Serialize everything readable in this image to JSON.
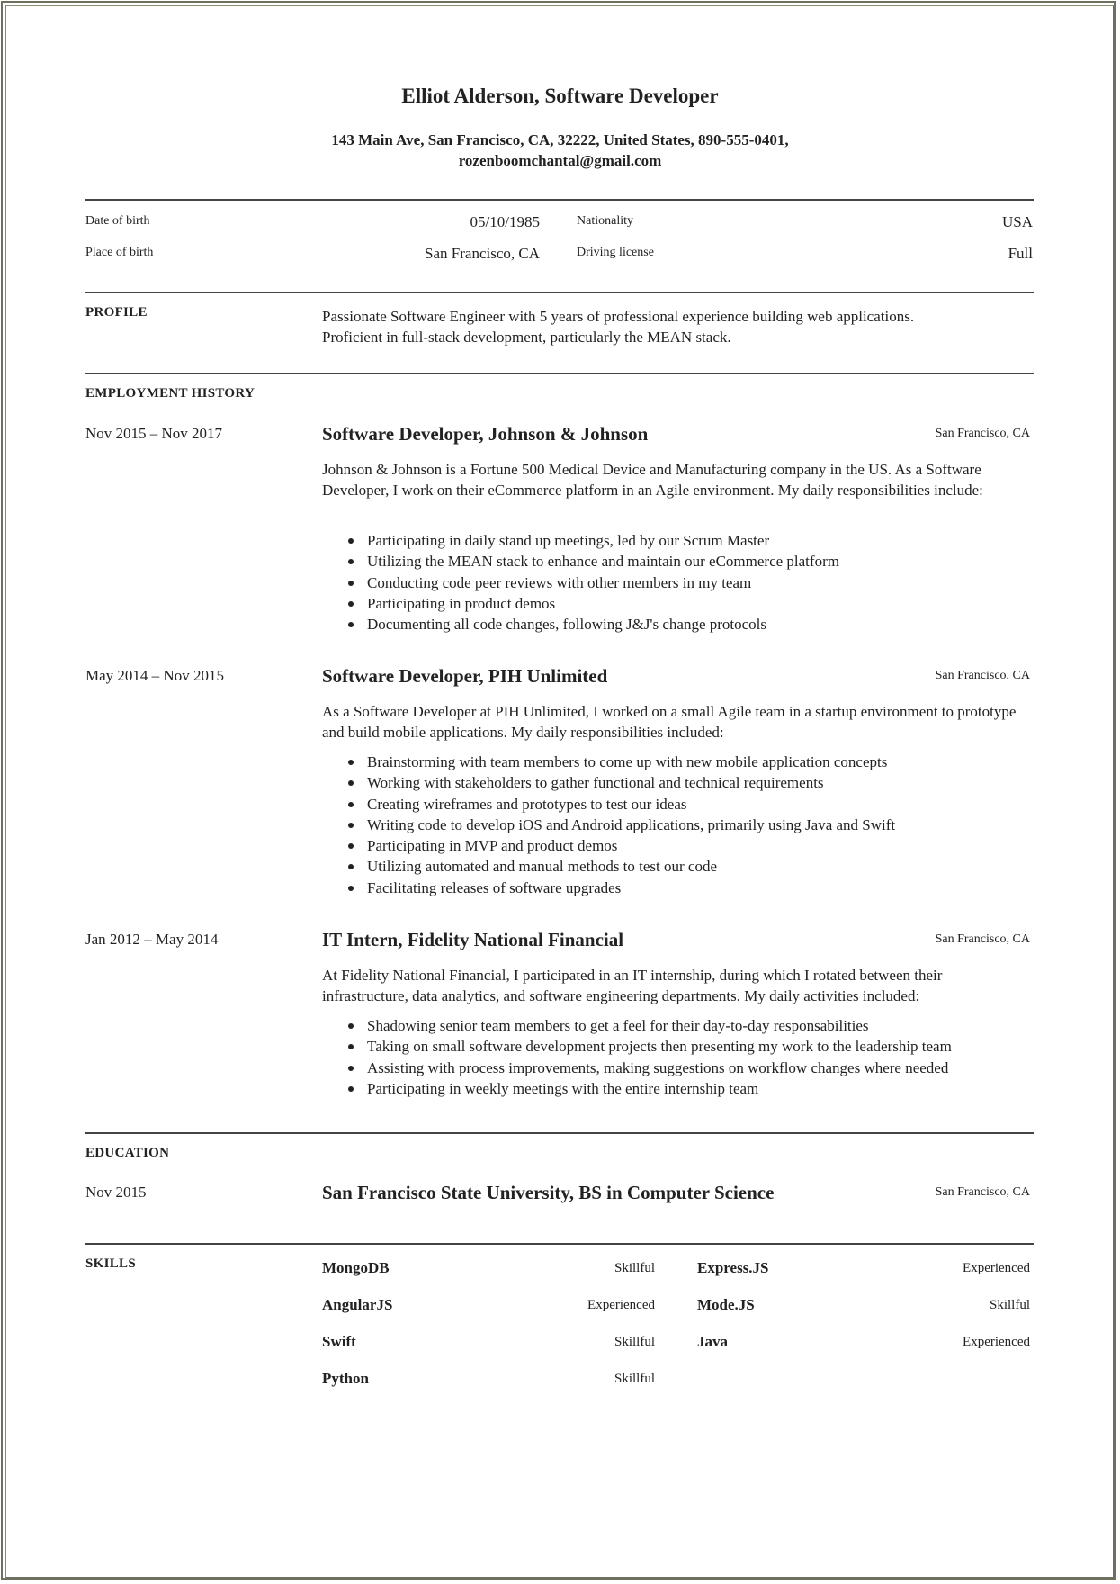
{
  "header": {
    "name": "Elliot Alderson, Software Developer",
    "contact_line1": "143 Main Ave, San Francisco, CA, 32222, United States, 890-555-0401,",
    "contact_line2": "rozenboomchantal@gmail.com"
  },
  "personal_info": [
    {
      "label": "Date of birth",
      "value": "05/10/1985"
    },
    {
      "label": "Place of birth",
      "value": "San Francisco, CA"
    },
    {
      "label": "Nationality",
      "value": "USA"
    },
    {
      "label": "Driving license",
      "value": "Full"
    }
  ],
  "profile": {
    "title": "PROFILE",
    "text_line1": "Passionate Software Engineer with 5 years of professional experience building web applications.",
    "text_line2": "Proficient in full-stack development, particularly the MEAN stack."
  },
  "employment": {
    "title": "EMPLOYMENT HISTORY",
    "jobs": [
      {
        "dates": "Nov 2015 – Nov 2017",
        "title": "Software Developer, Johnson & Johnson",
        "location": "San Francisco, CA",
        "description": "Johnson & Johnson is a Fortune 500 Medical Device and Manufacturing company in the US. As a Software Developer, I work on their eCommerce platform in an Agile environment. My daily responsibilities include:",
        "bullets": [
          "Participating in daily stand up meetings, led by our Scrum Master",
          "Utilizing the MEAN stack to enhance and maintain our eCommerce platform",
          "Conducting code peer reviews with other members in my team",
          "Participating in product demos",
          "Documenting all code changes, following J&J's change protocols"
        ]
      },
      {
        "dates": "May 2014 – Nov 2015",
        "title": "Software Developer, PIH Unlimited",
        "location": "San Francisco, CA",
        "description": "As a Software Developer at PIH Unlimited, I worked on a small Agile team in a startup environment to prototype and build mobile applications. My daily responsibilities included:",
        "bullets": [
          "Brainstorming with team members to come up with new mobile application concepts",
          "Working with stakeholders to gather functional and technical requirements",
          "Creating wireframes and prototypes to test our ideas",
          "Writing code to develop iOS and Android applications, primarily using Java and Swift",
          "Participating in MVP and product demos",
          "Utilizing automated and manual methods to test our code",
          "Facilitating releases of software upgrades"
        ]
      },
      {
        "dates": "Jan 2012 – May 2014",
        "title": "IT Intern, Fidelity National Financial",
        "location": "San Francisco, CA",
        "description": "At Fidelity National Financial, I participated in an IT internship, during which I rotated between their infrastructure, data analytics, and software engineering departments. My daily activities included:",
        "bullets": [
          "Shadowing senior team members to get a feel for their day-to-day responsabilities",
          "Taking on small software development projects then presenting my work to the leadership team",
          "Assisting with process improvements, making suggestions on workflow changes where needed",
          "Participating in weekly meetings with the entire internship team"
        ]
      }
    ]
  },
  "education": {
    "title": "EDUCATION",
    "entries": [
      {
        "date": "Nov 2015",
        "title": "San Francisco State University, BS in Computer Science",
        "location": "San Francisco, CA"
      }
    ]
  },
  "skills": {
    "title": "SKILLS",
    "items": [
      {
        "name": "MongoDB",
        "level": "Skillful"
      },
      {
        "name": "Express.JS",
        "level": "Experienced"
      },
      {
        "name": "AngularJS",
        "level": "Experienced"
      },
      {
        "name": "Mode.JS",
        "level": "Skillful"
      },
      {
        "name": "Swift",
        "level": "Skillful"
      },
      {
        "name": "Java",
        "level": "Experienced"
      },
      {
        "name": "Python",
        "level": "Skillful"
      }
    ]
  }
}
